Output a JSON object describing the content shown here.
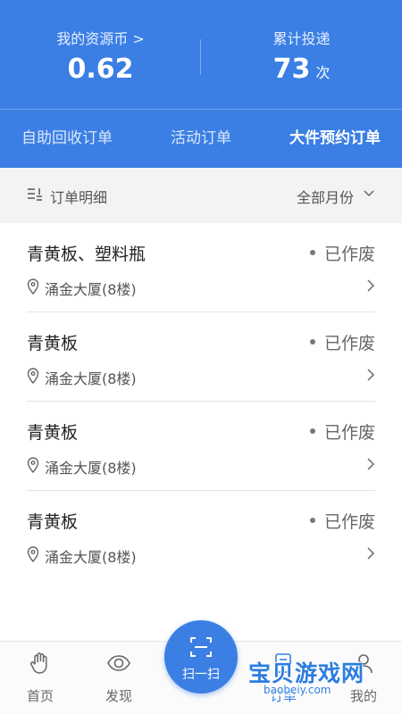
{
  "stats": {
    "coins_label": "我的资源币 >",
    "coins_value": "0.62",
    "deliveries_label": "累计投递",
    "deliveries_value": "73",
    "deliveries_unit": "次"
  },
  "tabs": [
    {
      "label": "自助回收订单"
    },
    {
      "label": "活动订单"
    },
    {
      "label": "大件预约订单",
      "active": true
    }
  ],
  "filter": {
    "title": "订单明细",
    "month": "全部月份"
  },
  "orders": [
    {
      "title": "青黄板、塑料瓶",
      "status": "已作废",
      "address": "涌金大厦(8楼)"
    },
    {
      "title": "青黄板",
      "status": "已作废",
      "address": "涌金大厦(8楼)"
    },
    {
      "title": "青黄板",
      "status": "已作废",
      "address": "涌金大厦(8楼)"
    },
    {
      "title": "青黄板",
      "status": "已作废",
      "address": "涌金大厦(8楼)"
    }
  ],
  "bottom_nav": {
    "home": "首页",
    "discover": "发现",
    "scan": "扫一扫",
    "orders": "订单",
    "mine": "我的"
  },
  "watermark": {
    "text": "宝贝游戏网",
    "url": "baobeiy.com"
  },
  "colors": {
    "primary": "#3b7fe4",
    "status_dot": "#777777"
  }
}
